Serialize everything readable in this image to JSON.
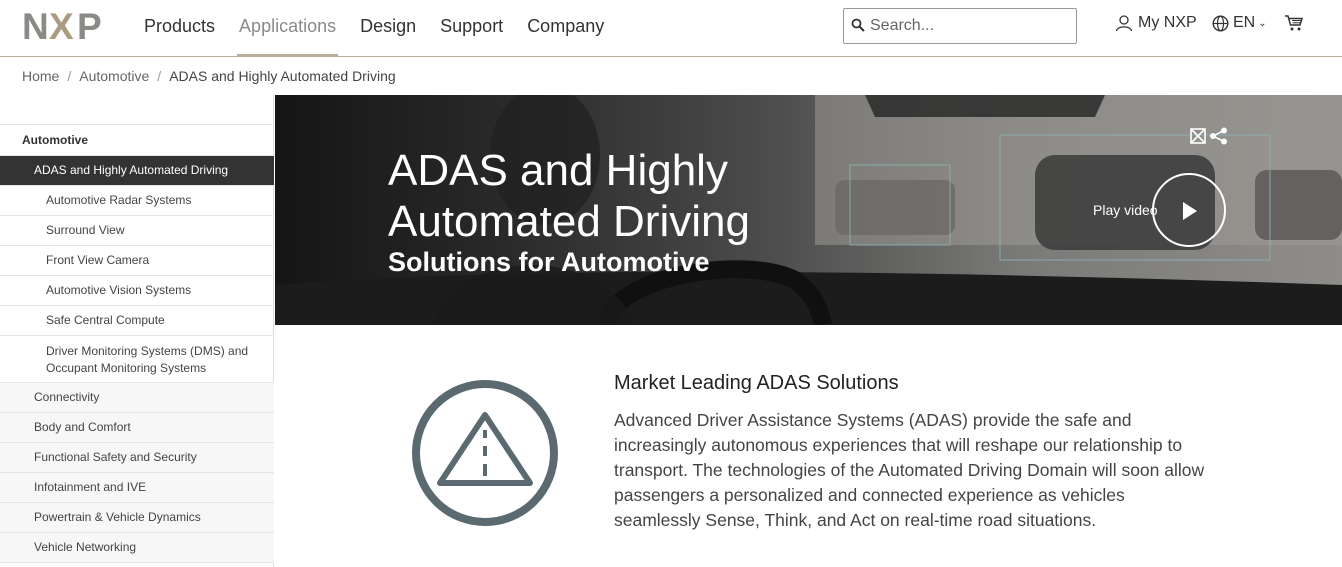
{
  "header": {
    "logo_text": "NXP",
    "nav": [
      "Products",
      "Applications",
      "Design",
      "Support",
      "Company"
    ],
    "active_nav": "Applications",
    "search_placeholder": "Search...",
    "account_label": "My NXP",
    "language_label": "EN",
    "icons": {
      "search": "magnifier-icon",
      "account": "user-icon",
      "language": "globe-icon",
      "cart": "cart-icon"
    }
  },
  "breadcrumb": {
    "items": [
      "Home",
      "Automotive",
      "ADAS and Highly Automated Driving"
    ],
    "separator": "/"
  },
  "sidebar": {
    "heading": "Automotive",
    "active": "ADAS and Highly Automated Driving",
    "subitems": [
      "Automotive Radar Systems",
      "Surround View",
      "Front View Camera",
      "Automotive Vision Systems",
      "Safe Central Compute",
      "Driver Monitoring Systems (DMS) and Occupant Monitoring Systems"
    ],
    "items": [
      "Connectivity",
      "Body and Comfort",
      "Functional Safety and Security",
      "Infotainment and IVE",
      "Powertrain & Vehicle Dynamics",
      "Vehicle Networking"
    ]
  },
  "hero": {
    "title_line1": "ADAS and Highly",
    "title_line2": "Automated Driving",
    "subtitle": "Solutions for Automotive",
    "play_label": "Play video"
  },
  "content": {
    "title": "Market Leading ADAS Solutions",
    "body": "Advanced Driver Assistance Systems (ADAS) provide the safe and increasingly autonomous experiences that will reshape our relationship to transport. The technologies of the Automated Driving Domain will soon allow passengers a personalized and connected experience as vehicles seamlessly Sense, Think, and Act on real-time road situations."
  },
  "colors": {
    "nav_underline": "#b9ad9c",
    "sidebar_active_bg": "#333333",
    "icon_stroke": "#5a6a70"
  }
}
